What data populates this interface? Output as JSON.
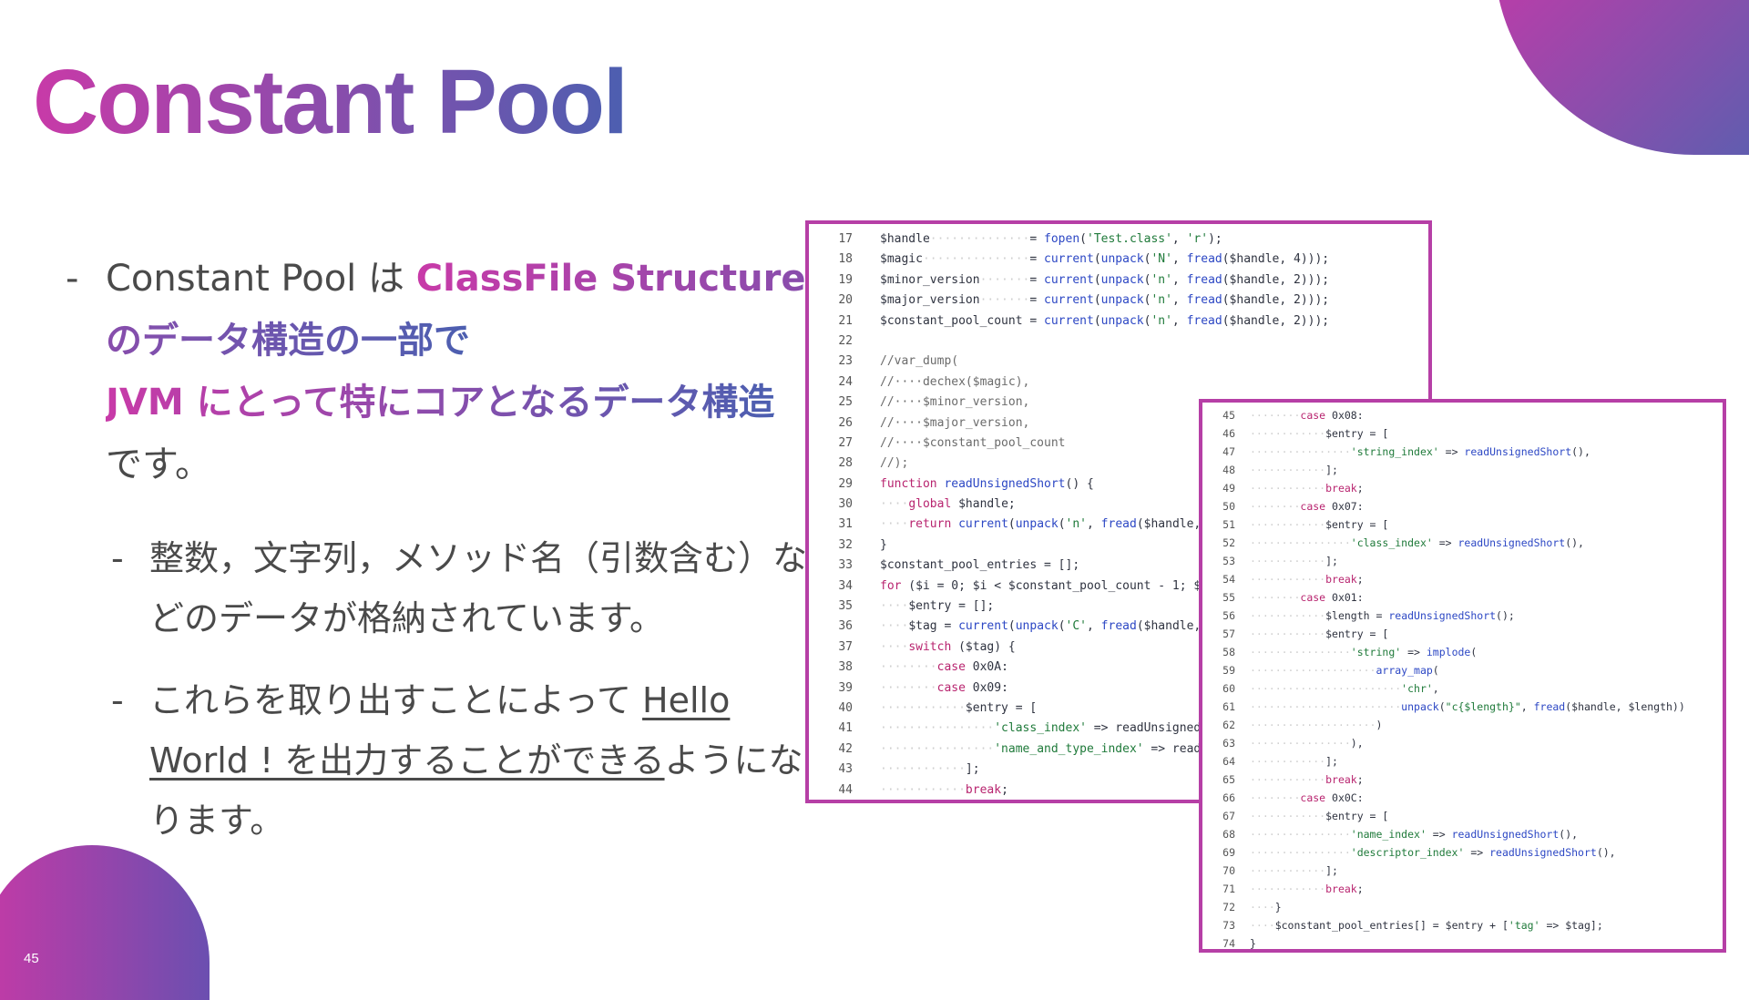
{
  "slide": {
    "title": "Constant Pool",
    "page_number": "45",
    "brand_colors": {
      "magenta": "#c83aa8",
      "blue": "#4c5fb0",
      "border": "#b63fa6"
    }
  },
  "bullets": {
    "b1": {
      "dash": "-",
      "plain1": "Constant Pool は ",
      "hl1": "ClassFile Structure のデータ構造の一部で",
      "hl2": "JVM にとって特にコアとなるデータ構造",
      "plain2": "です。"
    },
    "b2": {
      "dash": "-",
      "text": "整数，文字列，メソッド名（引数含む）などのデータが格納されています。"
    },
    "b3": {
      "dash": "-",
      "plain1": "これらを取り出すことによって ",
      "underlined": "Hello World ! を出力することができる",
      "plain2": "ようになります。"
    }
  },
  "code": {
    "panel1": [
      {
        "n": "17",
        "t": "$handle··············= fopen('Test.class', 'r');"
      },
      {
        "n": "18",
        "t": "$magic···············= current(unpack('N', fread($handle, 4)));"
      },
      {
        "n": "19",
        "t": "$minor_version·······= current(unpack('n', fread($handle, 2)));"
      },
      {
        "n": "20",
        "t": "$major_version·······= current(unpack('n', fread($handle, 2)));"
      },
      {
        "n": "21",
        "t": "$constant_pool_count = current(unpack('n', fread($handle, 2)));"
      },
      {
        "n": "22",
        "t": ""
      },
      {
        "n": "23",
        "t": "//var_dump("
      },
      {
        "n": "24",
        "t": "//····dechex($magic),"
      },
      {
        "n": "25",
        "t": "//····$minor_version,"
      },
      {
        "n": "26",
        "t": "//····$major_version,"
      },
      {
        "n": "27",
        "t": "//····$constant_pool_count"
      },
      {
        "n": "28",
        "t": "//);"
      },
      {
        "n": "29",
        "t": "function readUnsignedShort() {"
      },
      {
        "n": "30",
        "t": "····global $handle;"
      },
      {
        "n": "31",
        "t": "····return current(unpack('n', fread($handle,"
      },
      {
        "n": "32",
        "t": "}"
      },
      {
        "n": "33",
        "t": "$constant_pool_entries = [];"
      },
      {
        "n": "34",
        "t": "for ($i = 0; $i < $constant_pool_count - 1; $"
      },
      {
        "n": "35",
        "t": "····$entry = [];"
      },
      {
        "n": "36",
        "t": "····$tag = current(unpack('C', fread($handle,"
      },
      {
        "n": "37",
        "t": "····switch ($tag) {"
      },
      {
        "n": "38",
        "t": "········case 0x0A:"
      },
      {
        "n": "39",
        "t": "········case 0x09:"
      },
      {
        "n": "40",
        "t": "············$entry = ["
      },
      {
        "n": "41",
        "t": "················'class_index' => readUnsigned"
      },
      {
        "n": "42",
        "t": "················'name_and_type_index' => read"
      },
      {
        "n": "43",
        "t": "············];"
      },
      {
        "n": "44",
        "t": "············break;"
      }
    ],
    "panel2": [
      {
        "n": "45",
        "t": "········case 0x08:"
      },
      {
        "n": "46",
        "t": "············$entry = ["
      },
      {
        "n": "47",
        "t": "················'string_index' => readUnsignedShort(),"
      },
      {
        "n": "48",
        "t": "············];"
      },
      {
        "n": "49",
        "t": "············break;"
      },
      {
        "n": "50",
        "t": "········case 0x07:"
      },
      {
        "n": "51",
        "t": "············$entry = ["
      },
      {
        "n": "52",
        "t": "················'class_index' => readUnsignedShort(),"
      },
      {
        "n": "53",
        "t": "············];"
      },
      {
        "n": "54",
        "t": "············break;"
      },
      {
        "n": "55",
        "t": "········case 0x01:"
      },
      {
        "n": "56",
        "t": "············$length = readUnsignedShort();"
      },
      {
        "n": "57",
        "t": "············$entry = ["
      },
      {
        "n": "58",
        "t": "················'string' => implode("
      },
      {
        "n": "59",
        "t": "····················array_map("
      },
      {
        "n": "60",
        "t": "························'chr',"
      },
      {
        "n": "61",
        "t": "························unpack(\"c{$length}\", fread($handle, $length))"
      },
      {
        "n": "62",
        "t": "····················)"
      },
      {
        "n": "63",
        "t": "················),"
      },
      {
        "n": "64",
        "t": "············];"
      },
      {
        "n": "65",
        "t": "············break;"
      },
      {
        "n": "66",
        "t": "········case 0x0C:"
      },
      {
        "n": "67",
        "t": "············$entry = ["
      },
      {
        "n": "68",
        "t": "················'name_index' => readUnsignedShort(),"
      },
      {
        "n": "69",
        "t": "················'descriptor_index' => readUnsignedShort(),"
      },
      {
        "n": "70",
        "t": "············];"
      },
      {
        "n": "71",
        "t": "············break;"
      },
      {
        "n": "72",
        "t": "····}"
      },
      {
        "n": "73",
        "t": "····$constant_pool_entries[] = $entry + ['tag' => $tag];"
      },
      {
        "n": "74",
        "t": "}"
      }
    ]
  }
}
